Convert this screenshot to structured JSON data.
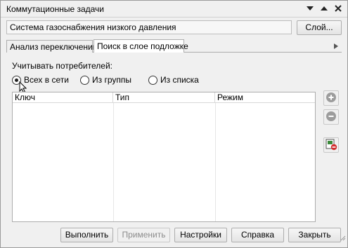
{
  "window": {
    "title": "Коммутационные задачи"
  },
  "system": {
    "name": "Система газоснабжения низкого давления",
    "layer_button": "Слой..."
  },
  "tabs": [
    {
      "label": "Анализ переключений"
    },
    {
      "label": "Поиск в слое подложке"
    }
  ],
  "panel": {
    "consumers_label": "Учитывать потребителей:",
    "radios": [
      {
        "label": "Всех в сети",
        "checked": true
      },
      {
        "label": "Из группы",
        "checked": false
      },
      {
        "label": "Из списка",
        "checked": false
      }
    ],
    "table": {
      "columns": [
        "Ключ",
        "Тип",
        "Режим"
      ],
      "rows": []
    }
  },
  "buttons": {
    "run": "Выполнить",
    "apply": "Применить",
    "settings": "Настройки",
    "help": "Справка",
    "close": "Закрыть"
  },
  "icons": {
    "add": "plus-circle-icon",
    "remove": "minus-circle-icon",
    "layer": "layer-remove-icon"
  }
}
